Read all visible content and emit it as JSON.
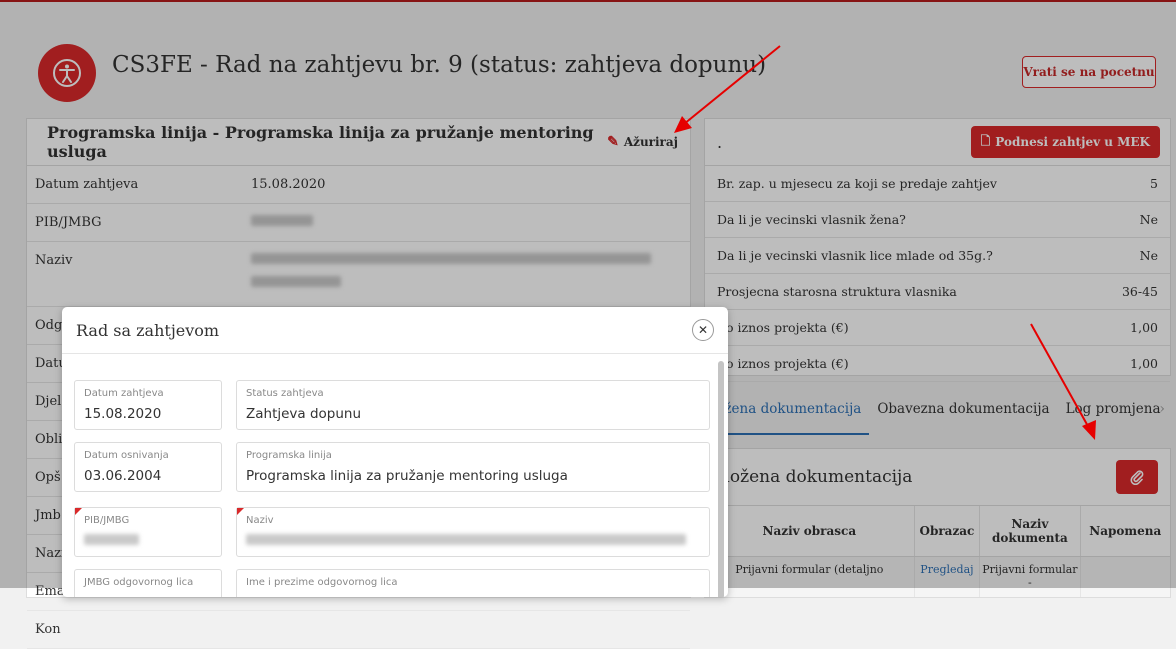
{
  "header": {
    "title": "CS3FE - Rad na zahtjevu br. 9 (status: zahtjeva dopunu)",
    "back_button": "Vrati se na pocetnu",
    "logo_icon": "accessibility-icon"
  },
  "left_card": {
    "title": "Programska linija - Programska linija za pružanje mentoring usluga",
    "update_label": "Ažuriraj",
    "rows": [
      {
        "key": "Datum zahtjeva",
        "value": "15.08.2020"
      },
      {
        "key": "PIB/JMBG",
        "value": ""
      },
      {
        "key": "Naziv",
        "value": ""
      },
      {
        "key": "Odg",
        "value": ""
      },
      {
        "key": "Datu",
        "value": ""
      },
      {
        "key": "Djel",
        "value": ""
      },
      {
        "key": "Obli",
        "value": ""
      },
      {
        "key": "Opš",
        "value": ""
      },
      {
        "key": "Jmb",
        "value": ""
      },
      {
        "key": "Nazi",
        "value": ""
      },
      {
        "key": "Ema",
        "value": ""
      },
      {
        "key": "Kon",
        "value": ""
      }
    ]
  },
  "right_card": {
    "title": ".",
    "submit_button": "Podnesi zahtjev u MEK",
    "rows": [
      {
        "key": "Br. zap. u mjesecu za koji se predaje zahtjev",
        "value": "5"
      },
      {
        "key": "Da li je vecinski vlasnik žena?",
        "value": "Ne"
      },
      {
        "key": "Da li je vecinski vlasnik lice mlade od 35g.?",
        "value": "Ne"
      },
      {
        "key": "Prosjecna starosna struktura vlasnika",
        "value": "36-45"
      },
      {
        "key": "ito iznos projekta (€)",
        "value": "1,00"
      },
      {
        "key": "ito iznos projekta (€)",
        "value": "1,00"
      }
    ]
  },
  "tabs": [
    {
      "label": "ložena dokumentacija",
      "active": true
    },
    {
      "label": "Obavezna dokumentacija",
      "active": false
    },
    {
      "label": "Log promjena",
      "active": false
    }
  ],
  "docs_card": {
    "title": "iložena dokumentacija",
    "columns": [
      "Naziv obrasca",
      "Obrazac",
      "Naziv dokumenta",
      "Napomena"
    ],
    "row": {
      "naziv_obrasca": "Prijavni formular (detaljno",
      "obrazac": "Pregledaj",
      "naziv_dokumenta": "Prijavni formular -",
      "napomena": ""
    }
  },
  "modal": {
    "title": "Rad sa zahtjevom",
    "fields": [
      {
        "label": "Datum zahtjeva",
        "value": "15.08.2020"
      },
      {
        "label": "Status zahtjeva",
        "value": "Zahtjeva dopunu"
      },
      {
        "label": "Datum osnivanja",
        "value": "03.06.2004"
      },
      {
        "label": "Programska linija",
        "value": "Programska linija za pružanje mentoring usluga"
      },
      {
        "label": "PIB/JMBG",
        "value": ""
      },
      {
        "label": "Naziv",
        "value": ""
      },
      {
        "label": "JMBG odgovornog lica",
        "value": ""
      },
      {
        "label": "Ime i prezime odgovornog lica",
        "value": ""
      }
    ]
  },
  "colors": {
    "accent": "#d9292b",
    "link": "#2c6fb4",
    "arrow": "#e60000"
  }
}
